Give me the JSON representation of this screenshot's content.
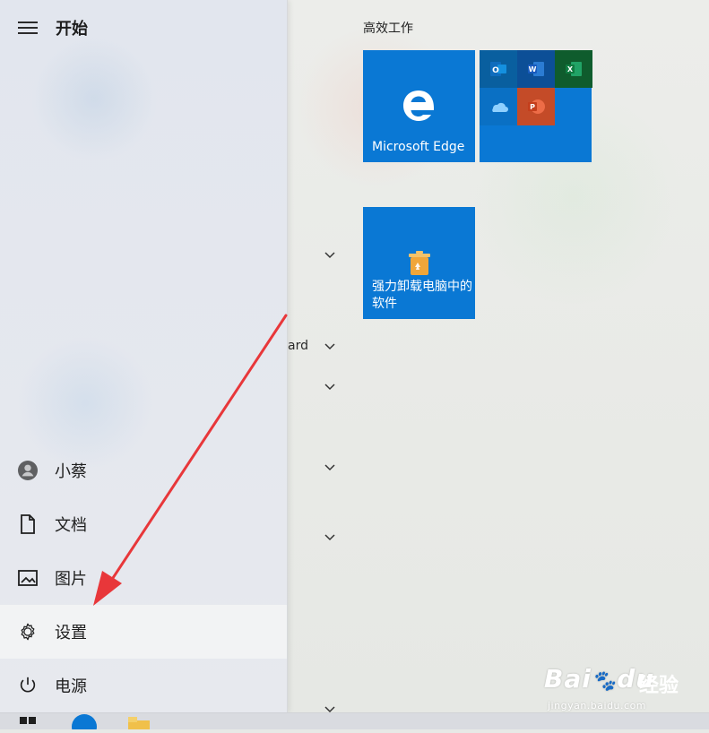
{
  "start_menu": {
    "title": "开始",
    "nav": [
      {
        "label": "小蔡",
        "icon": "user-avatar-icon"
      },
      {
        "label": "文档",
        "icon": "document-icon"
      },
      {
        "label": "图片",
        "icon": "picture-icon"
      },
      {
        "label": "设置",
        "icon": "gear-icon",
        "active": true
      },
      {
        "label": "电源",
        "icon": "power-icon"
      }
    ],
    "partial_label": "ard"
  },
  "tiles": {
    "group_title": "高效工作",
    "edge_label": "Microsoft Edge",
    "uninstall_label": "强力卸载电脑中的软件"
  },
  "colors": {
    "tile_blue": "#0a78d4",
    "arrow_red": "#e8373a"
  },
  "watermark": {
    "brand": "Bai",
    "brand2": "du",
    "jingyan": "经验",
    "url": "jingyan.baidu.com"
  }
}
